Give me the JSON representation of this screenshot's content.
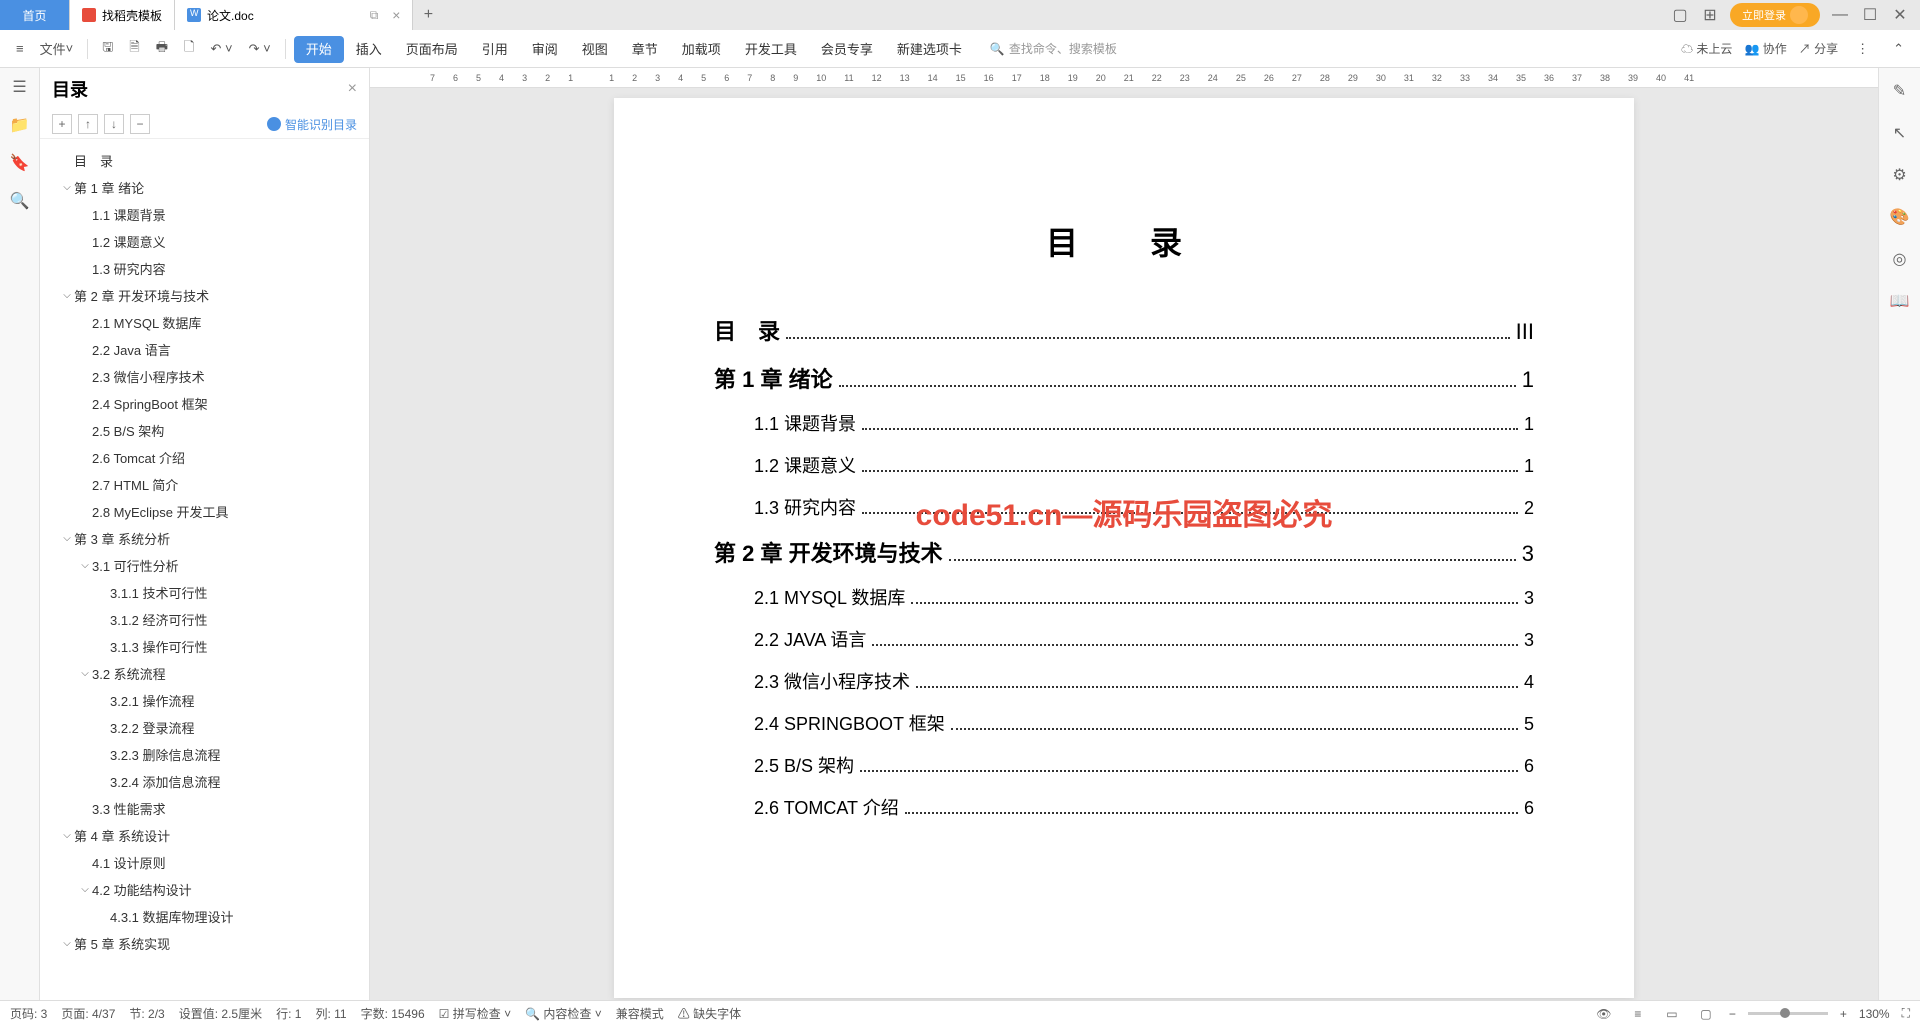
{
  "tabs": {
    "home": "首页",
    "template": "找稻壳模板",
    "doc": "论文.doc"
  },
  "login": "立即登录",
  "file_menu": "文件",
  "ribbon": [
    "开始",
    "插入",
    "页面布局",
    "引用",
    "审阅",
    "视图",
    "章节",
    "加载项",
    "开发工具",
    "会员专享",
    "新建选项卡"
  ],
  "search_placeholder": "查找命令、搜索模板",
  "cloud": "未上云",
  "collab": "协作",
  "share": "分享",
  "outline": {
    "title": "目录",
    "smart": "智能识别目录",
    "items": [
      {
        "level": 1,
        "text": "目　录",
        "expand": ""
      },
      {
        "level": 1,
        "text": "第 1 章  绪论",
        "expand": "v"
      },
      {
        "level": 2,
        "text": "1.1  课题背景"
      },
      {
        "level": 2,
        "text": "1.2  课题意义"
      },
      {
        "level": 2,
        "text": "1.3  研究内容"
      },
      {
        "level": 1,
        "text": "第 2 章  开发环境与技术",
        "expand": "v"
      },
      {
        "level": 2,
        "text": "2.1  MYSQL 数据库"
      },
      {
        "level": 2,
        "text": "2.2  Java 语言"
      },
      {
        "level": 2,
        "text": "2.3  微信小程序技术"
      },
      {
        "level": 2,
        "text": "2.4  SpringBoot 框架"
      },
      {
        "level": 2,
        "text": "2.5  B/S 架构"
      },
      {
        "level": 2,
        "text": "2.6  Tomcat  介绍"
      },
      {
        "level": 2,
        "text": "2.7  HTML 简介"
      },
      {
        "level": 2,
        "text": "2.8  MyEclipse 开发工具"
      },
      {
        "level": 1,
        "text": "第 3 章  系统分析",
        "expand": "v"
      },
      {
        "level": 2,
        "text": "3.1  可行性分析",
        "expand": "v"
      },
      {
        "level": 3,
        "text": "3.1.1  技术可行性"
      },
      {
        "level": 3,
        "text": "3.1.2  经济可行性"
      },
      {
        "level": 3,
        "text": "3.1.3  操作可行性"
      },
      {
        "level": 2,
        "text": "3.2  系统流程",
        "expand": "v"
      },
      {
        "level": 3,
        "text": "3.2.1  操作流程"
      },
      {
        "level": 3,
        "text": "3.2.2  登录流程"
      },
      {
        "level": 3,
        "text": "3.2.3  删除信息流程"
      },
      {
        "level": 3,
        "text": "3.2.4  添加信息流程"
      },
      {
        "level": 2,
        "text": "3.3  性能需求"
      },
      {
        "level": 1,
        "text": "第 4 章  系统设计",
        "expand": "v"
      },
      {
        "level": 2,
        "text": "4.1  设计原则"
      },
      {
        "level": 2,
        "text": "4.2  功能结构设计",
        "expand": "v"
      },
      {
        "level": 3,
        "text": "4.3.1  数据库物理设计"
      },
      {
        "level": 1,
        "text": "第 5 章  系统实现",
        "expand": "v"
      }
    ]
  },
  "ruler_marks": [
    "7",
    "6",
    "5",
    "4",
    "3",
    "2",
    "1",
    "",
    "1",
    "2",
    "3",
    "4",
    "5",
    "6",
    "7",
    "8",
    "9",
    "10",
    "11",
    "12",
    "13",
    "14",
    "15",
    "16",
    "17",
    "18",
    "19",
    "20",
    "21",
    "22",
    "23",
    "24",
    "25",
    "26",
    "27",
    "28",
    "29",
    "30",
    "31",
    "32",
    "33",
    "34",
    "35",
    "36",
    "37",
    "38",
    "39",
    "40",
    "41"
  ],
  "document": {
    "title": "目　录",
    "watermark": "code51.cn—源码乐园盗图必究",
    "toc": [
      {
        "level": 1,
        "text": "目　录",
        "page": "III"
      },
      {
        "level": 1,
        "text": "第 1 章  绪论",
        "page": "1"
      },
      {
        "level": 2,
        "text": "1.1  课题背景",
        "page": "1"
      },
      {
        "level": 2,
        "text": "1.2  课题意义",
        "page": "1"
      },
      {
        "level": 2,
        "text": "1.3  研究内容",
        "page": "2"
      },
      {
        "level": 1,
        "text": "第 2 章  开发环境与技术",
        "page": "3"
      },
      {
        "level": 2,
        "text": "2.1 MYSQL 数据库",
        "page": "3"
      },
      {
        "level": 2,
        "text": "2.2 JAVA 语言",
        "page": "3"
      },
      {
        "level": 2,
        "text": "2.3  微信小程序技术",
        "page": "4"
      },
      {
        "level": 2,
        "text": "2.4 SPRINGBOOT 框架",
        "page": "5"
      },
      {
        "level": 2,
        "text": "2.5 B/S  架构",
        "page": "6"
      },
      {
        "level": 2,
        "text": "2.6 TOMCAT  介绍",
        "page": "6"
      }
    ]
  },
  "status": {
    "page_no": "页码: 3",
    "page": "页面: 4/37",
    "section": "节: 2/3",
    "setting": "设置值: 2.5厘米",
    "row": "行: 1",
    "col": "列: 11",
    "words": "字数: 15496",
    "spellcheck": "拼写检查",
    "content_check": "内容检查",
    "compat": "兼容模式",
    "missing_font": "缺失字体",
    "zoom": "130%"
  }
}
